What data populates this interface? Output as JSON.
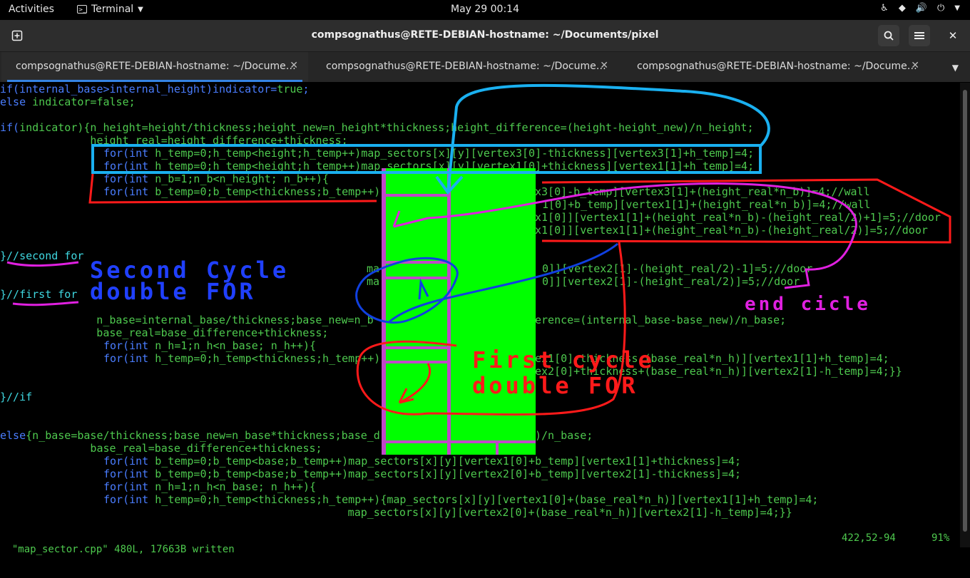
{
  "topbar": {
    "activities": "Activities",
    "app_name": "Terminal",
    "clock": "May 29  00:14"
  },
  "window": {
    "title": "compsognathus@RETE-DEBIAN-hostname: ~/Documents/pixel"
  },
  "tabs": [
    {
      "label": "compsognathus@RETE-DEBIAN-hostname: ~/Docume…",
      "active": true
    },
    {
      "label": "compsognathus@RETE-DEBIAN-hostname: ~/Docume…",
      "active": false
    },
    {
      "label": "compsognathus@RETE-DEBIAN-hostname: ~/Docume…",
      "active": false
    }
  ],
  "code": {
    "l0a": "if(",
    "l0b": "internal_base>internal_height)indicator=",
    "l0c": "true",
    "l0d": ";",
    "l1a": "else",
    "l1b": " indicator=",
    "l1c": "false",
    "l1d": ";",
    "l3a": "if(",
    "l3b": "indicator){n_height=height/thickness;height_new=n_height*thickness;height_difference=(height-height_new)/n_height;",
    "l4": "              height_real=height_difference+thickness;",
    "l5a": "for(",
    "l5b": "int",
    "l5c": " h_temp=0;h_temp<height;h_temp++)map_sectors[x][y][vertex3[0]-thickness][vertex3[1]+h_temp]=4;",
    "l6a": "for(",
    "l6b": "int",
    "l6c": " h_temp=0;h_temp<height;h_temp++)map_sectors[x][y][vertex1[0]+thickness][vertex1[1]+h_temp]=4;",
    "l7a": "for(",
    "l7b": "int",
    "l7c": " n_b=1;n_b<n_height; n_b++){",
    "l8a": "for(",
    "l8b": "int",
    "l8c": " b_temp=0;b_temp<thickness;b_temp++)",
    "r8": "x3[0]-b_temp][vertex3[1]+(height_real*n_b)]=4;//wall",
    "r9": "1[0]+b_temp][vertex1[1]+(height_real*n_b)]=4;//wall",
    "r10": "x1[0]][vertex1[1]+(height_real*n_b)-(height_real/2)+1]=5;//door",
    "r11": "x1[0]][vertex1[1]+(height_real*n_b)-(height_real/2)]=5;//door",
    "c_second": "}//second for",
    "m15a": "ma",
    "r15": "0]][vertex2[1]-(height_real/2)-1]=5;//door",
    "m16a": "ma",
    "r16": "0]][vertex2[1]-(height_real/2)]=5;//door",
    "c_first": "}//first for",
    "l19": "          n_base=internal_base/thickness;base_new=n_b",
    "r19": "erence=(internal_base-base_new)/n_base;",
    "l20": "          base_real=base_difference+thickness;",
    "l21a": "for(",
    "l21b": "int",
    "l21c": " n_h=1;n_h<n_base; n_h++){",
    "l22a": "for(",
    "l22b": "int",
    "l22c": " h_temp=0;h_temp<thickness;h_temp++)",
    "r22": "ex1[0]-thickness-(base_real*n_h)][vertex1[1]+h_temp]=4;",
    "r23": "ex2[0]+thickness+(base_real*n_h)][vertex2[1]-h_temp]=4;}}",
    "c_if": "}//if",
    "l28a": "else",
    "l28b": "{n_base=base/thickness;base_new=n_base*thickness;base_d",
    "r28": ")/n_base;",
    "l29": "              base_real=base_difference+thickness;",
    "l30a": "for(",
    "l30b": "int",
    "l30c": " b_temp=0;b_temp<base;b_temp++)map_sectors[x][y][vertex1[0]+b_temp][vertex1[1]+thickness]=4;",
    "l31a": "for(",
    "l31b": "int",
    "l31c": " b_temp=0;b_temp<base;b_temp++)map_sectors[x][y][vertex2[0]+b_temp][vertex2[1]-thickness]=4;",
    "l32a": "for(",
    "l32b": "int",
    "l32c": " n_h=1;n_h<n_base; n_h++){",
    "l33a": "for(",
    "l33b": "int",
    "l33c": " h_temp=0;h_temp<thickness;h_temp++){map_sectors[x][y][vertex1[0]+(base_real*n_h)][vertex1[1]+h_temp]=4;",
    "l34": "                                                      map_sectors[x][y][vertex2[0]+(base_real*n_h)][vertex2[1]-h_temp]=4;}}"
  },
  "status": {
    "message": "\"map_sector.cpp\" 480L, 17663B written",
    "position": "422,52-94",
    "percent": "91%"
  },
  "annotations": {
    "second_cycle": "Second Cycle",
    "double_for_1": "double FOR",
    "end_cicle": "end cicle",
    "first_cycle": "First cycle",
    "double_for_2": "double FOR"
  },
  "colors": {
    "accent": "#3584e4",
    "pixel_fill": "#00ff00",
    "pixel_lines": "#c048c8"
  }
}
